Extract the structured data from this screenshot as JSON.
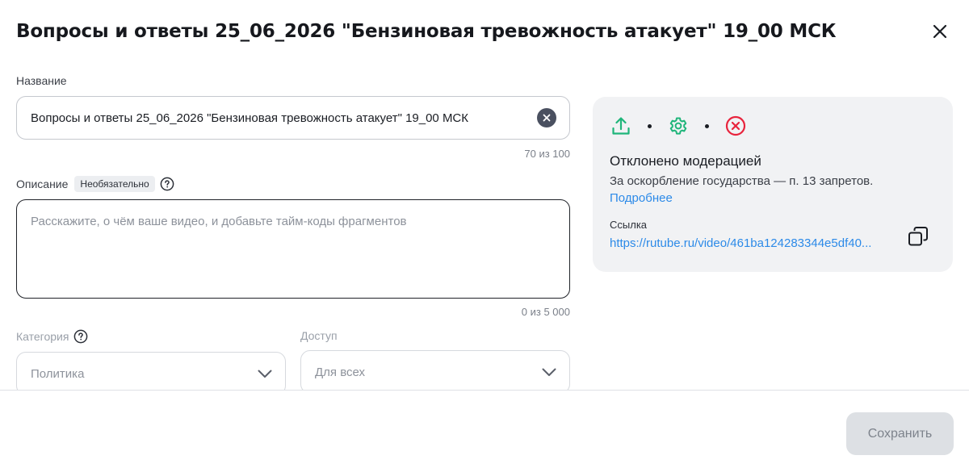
{
  "header": {
    "title": "Вопросы и ответы 25_06_2026 \"Бензиновая тревожность атакует\" 19_00 МСК",
    "close_icon": "close-icon"
  },
  "form": {
    "title_field": {
      "label": "Название",
      "value": "Вопросы и ответы 25_06_2026 \"Бензиновая тревожность атакует\" 19_00 МСК",
      "counter": "70 из 100",
      "clear_icon": "clear-icon"
    },
    "description_field": {
      "label": "Описание",
      "badge": "Необязательно",
      "help_icon": "help-icon",
      "placeholder": "Расскажите, о чём ваше видео, и добавьте тайм-коды фрагментов",
      "counter": "0 из 5 000"
    },
    "category_field": {
      "label": "Категория",
      "help_icon": "help-icon",
      "value": "Политика",
      "chevron_icon": "chevron-down-icon"
    },
    "access_field": {
      "label": "Доступ",
      "value": "Для всех",
      "chevron_icon": "chevron-down-icon"
    }
  },
  "status": {
    "steps": [
      {
        "icon": "upload-icon",
        "color": "#1fb57a"
      },
      {
        "icon": "gear-icon",
        "color": "#1fb57a"
      },
      {
        "icon": "rejected-icon",
        "color": "#e8233c"
      }
    ],
    "title": "Отклонено модерацией",
    "reason": "За оскорбление государства — п. 13 запретов.",
    "more_link": "Подробнее",
    "link_label": "Ссылка",
    "link_url": "https://rutube.ru/video/461ba124283344e5df40...",
    "copy_icon": "copy-icon"
  },
  "footer": {
    "save_label": "Сохранить"
  },
  "colors": {
    "accent_link": "#2c8ae8",
    "success": "#1fb57a",
    "error": "#e8233c"
  }
}
